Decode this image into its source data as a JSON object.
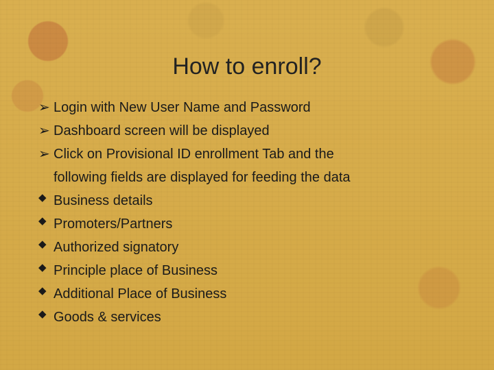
{
  "title": "How to enroll?",
  "bullets_main": [
    "Login with  New User Name and Password",
    "Dashboard screen  will  be displayed",
    "Click on Provisional ID enrollment Tab and the"
  ],
  "continuation": "following fields are displayed for feeding the data",
  "bullets_sub": [
    "Business details",
    "Promoters/Partners",
    "Authorized signatory",
    "Principle place of Business",
    "Additional  Place of Business",
    "Goods & services"
  ],
  "glyphs": {
    "arrow": "➢",
    "diamond": "◆"
  }
}
